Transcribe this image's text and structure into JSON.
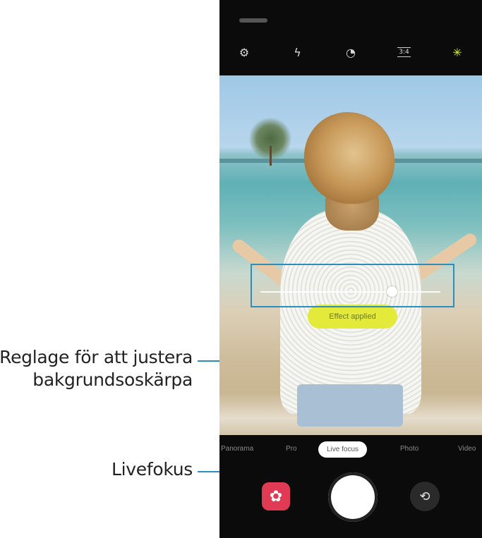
{
  "callouts": {
    "slider_line1": "Reglage för att justera",
    "slider_line2": "bakgrundsoskärpa",
    "livefocus": "Livefokus"
  },
  "colors": {
    "callout_accent": "#2a8fbf",
    "effect_pill": "#e4ea3a",
    "bixby": "#e03a55"
  },
  "camera": {
    "top_icons": [
      "settings-icon",
      "flash-off-icon",
      "timer-off-icon",
      "ratio-icon",
      "filter-sparkle-icon"
    ],
    "ratio_label": "3:4",
    "timer_label": "OFF",
    "effect_label": "Effect applied",
    "blur_level": 0.73,
    "modes": [
      "Panorama",
      "Pro",
      "Live focus",
      "Photo",
      "Video"
    ],
    "active_mode": "Live focus"
  }
}
